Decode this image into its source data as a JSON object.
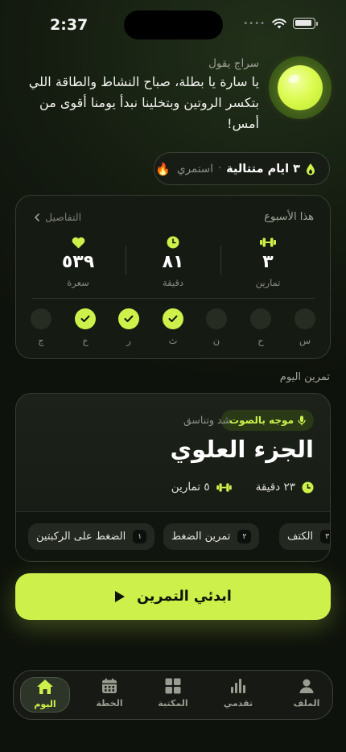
{
  "status": {
    "time": "2:37"
  },
  "coach": {
    "name": "سراج يقول",
    "message": "يا سارة يا بطلة، صباح النشاط والطاقة اللي بتكسر الروتين وبتخلينا نبدأ يومنا أقوى من أمس!"
  },
  "streak": {
    "count": "٣ ايام متتالية",
    "separator": "·",
    "keep": "استمري",
    "fire": "🔥"
  },
  "week": {
    "title": "هذا الأسبوع",
    "details": "التفاصيل",
    "stats": [
      {
        "value": "٣",
        "label": "تمارين",
        "icon": "dumbbell-icon"
      },
      {
        "value": "٨١",
        "label": "دقيقة",
        "icon": "clock-icon"
      },
      {
        "value": "٥٣٩",
        "label": "سعرة",
        "icon": "heart-icon"
      }
    ],
    "days": [
      {
        "label": "س",
        "done": false
      },
      {
        "label": "ح",
        "done": false
      },
      {
        "label": "ن",
        "done": false
      },
      {
        "label": "ث",
        "done": true
      },
      {
        "label": "ر",
        "done": true
      },
      {
        "label": "خ",
        "done": true
      },
      {
        "label": "ج",
        "done": false
      }
    ]
  },
  "today": {
    "section_label": "تمرين اليوم",
    "badge": "موجه بالصوت",
    "type": "شد وتناسق",
    "title": "الجزء العلوي",
    "duration": "٢٣ دقيقة",
    "exercises_count": "٥ تمارين",
    "exercises": [
      {
        "num": "٣",
        "name": "الكتف"
      },
      {
        "num": "٢",
        "name": "تمرين الضغط"
      },
      {
        "num": "١",
        "name": "الضغط على الركبتين"
      }
    ]
  },
  "start_button": {
    "label": "ابدئي التمرين"
  },
  "nav": {
    "items": [
      {
        "label": "اليوم",
        "icon": "home-icon",
        "active": true
      },
      {
        "label": "الخطة",
        "icon": "calendar-icon",
        "active": false
      },
      {
        "label": "المكتبة",
        "icon": "grid-icon",
        "active": false
      },
      {
        "label": "تقدمي",
        "icon": "chart-icon",
        "active": false
      },
      {
        "label": "الملف",
        "icon": "person-icon",
        "active": false
      }
    ]
  },
  "colors": {
    "accent": "#cdf14a",
    "background": "#141b10",
    "card": "#151a13"
  }
}
